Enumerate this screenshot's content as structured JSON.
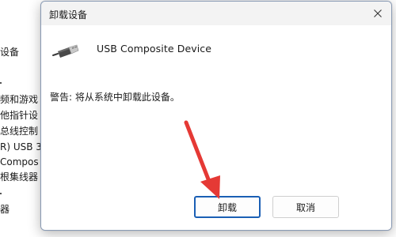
{
  "background_tree": {
    "items": [
      {
        "label": "设备"
      },
      {
        "label": "频和游戏"
      },
      {
        "label": "他指针设"
      },
      {
        "label": "总线控制"
      },
      {
        "label": "R) USB 3"
      },
      {
        "label": "Compos"
      },
      {
        "label": "根集线器"
      },
      {
        "label": "器"
      }
    ]
  },
  "dialog": {
    "title": "卸载设备",
    "close_icon": "close-icon",
    "device_icon": "usb-plug-icon",
    "device_name": "USB Composite Device",
    "warning": "警告: 将从系统中卸载此设备。",
    "buttons": {
      "uninstall": "卸载",
      "cancel": "取消"
    }
  },
  "annotation": {
    "arrow_color": "#e53935"
  },
  "colors": {
    "accent": "#1a5fb4",
    "dialog_bg": "#f3f3f3",
    "content_bg": "#ffffff"
  }
}
